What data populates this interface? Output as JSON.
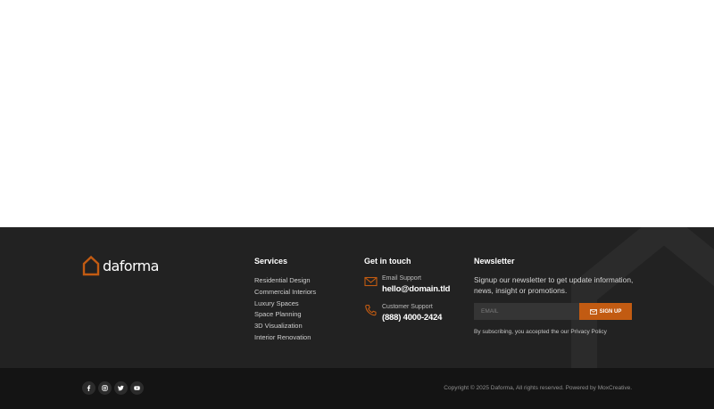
{
  "brand": {
    "name": "daforma",
    "accent_color": "#c25b12",
    "logo_icon": "house-outline-icon"
  },
  "services": {
    "title": "Services",
    "items": [
      {
        "label": "Residential Design"
      },
      {
        "label": "Commercial Interiors"
      },
      {
        "label": "Luxury Spaces"
      },
      {
        "label": "Space Planning"
      },
      {
        "label": "3D Visualization"
      },
      {
        "label": "Interior Renovation"
      }
    ]
  },
  "contact": {
    "title": "Get in touch",
    "email": {
      "label": "Email Support",
      "value": "hello@domain.tld",
      "icon": "envelope-icon"
    },
    "phone": {
      "label": "Customer Support",
      "value": "(888) 4000-2424",
      "icon": "phone-icon"
    }
  },
  "newsletter": {
    "title": "Newsletter",
    "text": "Signup our newsletter to get update information, news, insight or promotions.",
    "email_placeholder": "EMAIL",
    "email_value": "",
    "button_label": "SIGN UP",
    "button_icon": "envelope-icon",
    "privacy_note": "By subscribing, you accepted the our Privacy Policy"
  },
  "footer_bottom": {
    "socials": [
      {
        "name": "facebook",
        "icon": "facebook-icon"
      },
      {
        "name": "instagram",
        "icon": "instagram-icon"
      },
      {
        "name": "twitter",
        "icon": "twitter-icon"
      },
      {
        "name": "youtube",
        "icon": "youtube-icon"
      }
    ],
    "copyright": "Copyright © 2025 Daforma, All rights reserved. Powered by MoxCreative."
  },
  "colors": {
    "footer_bg": "#222222",
    "footer_bottom_bg": "#141414",
    "input_bg": "#353535"
  }
}
